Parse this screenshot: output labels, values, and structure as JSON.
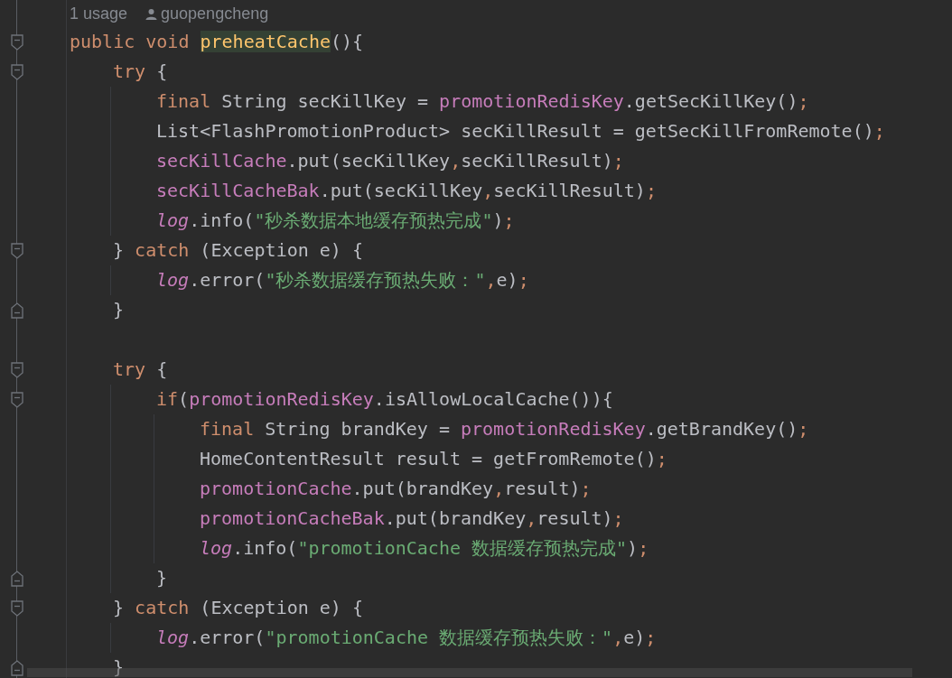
{
  "usage_hint": {
    "usages": "1 usage",
    "author": "guopengcheng"
  },
  "lines": [
    {
      "kind": "opener",
      "tokens": [
        {
          "kind": "keyword",
          "text": "public void "
        },
        {
          "kind": "declaration",
          "text": "preheatCache"
        },
        {
          "kind": "plain",
          "text": "(){"
        }
      ],
      "children": [
        {
          "kind": "opener",
          "tokens": [
            {
              "kind": "keyword",
              "text": "try"
            },
            {
              "kind": "plain",
              "text": " {"
            }
          ],
          "children": [
            {
              "kind": "statement",
              "tokens": [
                {
                  "kind": "keyword",
                  "text": "final"
                },
                {
                  "kind": "plain",
                  "text": " String secKillKey = "
                },
                {
                  "kind": "field",
                  "text": "promotionRedisKey"
                },
                {
                  "kind": "plain",
                  "text": ".getSecKillKey()"
                },
                {
                  "kind": "punct",
                  "text": ";"
                }
              ]
            },
            {
              "kind": "statement",
              "tokens": [
                {
                  "kind": "plain",
                  "text": "List<FlashPromotionProduct> secKillResult = getSecKillFromRemote()"
                },
                {
                  "kind": "punct",
                  "text": ";"
                }
              ]
            },
            {
              "kind": "statement",
              "tokens": [
                {
                  "kind": "field",
                  "text": "secKillCache"
                },
                {
                  "kind": "plain",
                  "text": ".put(secKillKey"
                },
                {
                  "kind": "punct",
                  "text": ","
                },
                {
                  "kind": "plain",
                  "text": "secKillResult)"
                },
                {
                  "kind": "punct",
                  "text": ";"
                }
              ]
            },
            {
              "kind": "statement",
              "tokens": [
                {
                  "kind": "field",
                  "text": "secKillCacheBak"
                },
                {
                  "kind": "plain",
                  "text": ".put(secKillKey"
                },
                {
                  "kind": "punct",
                  "text": ","
                },
                {
                  "kind": "plain",
                  "text": "secKillResult)"
                },
                {
                  "kind": "punct",
                  "text": ";"
                }
              ]
            },
            {
              "kind": "statement",
              "tokens": [
                {
                  "kind": "static",
                  "text": "log"
                },
                {
                  "kind": "plain",
                  "text": ".info("
                },
                {
                  "kind": "string",
                  "text": "\"秒杀数据本地缓存预热完成\""
                },
                {
                  "kind": "plain",
                  "text": ")"
                },
                {
                  "kind": "punct",
                  "text": ";"
                }
              ]
            }
          ]
        },
        {
          "kind": "opener",
          "tokens": [
            {
              "kind": "plain",
              "text": "} "
            },
            {
              "kind": "keyword",
              "text": "catch"
            },
            {
              "kind": "plain",
              "text": " (Exception e) {"
            }
          ],
          "children": [
            {
              "kind": "statement",
              "tokens": [
                {
                  "kind": "static",
                  "text": "log"
                },
                {
                  "kind": "plain",
                  "text": ".error("
                },
                {
                  "kind": "string",
                  "text": "\"秒杀数据缓存预热失败：\""
                },
                {
                  "kind": "punct",
                  "text": ","
                },
                {
                  "kind": "plain",
                  "text": "e)"
                },
                {
                  "kind": "punct",
                  "text": ";"
                }
              ]
            }
          ]
        },
        {
          "kind": "closer",
          "tokens": [
            {
              "kind": "plain",
              "text": "}"
            }
          ]
        },
        {
          "kind": "blank"
        },
        {
          "kind": "opener",
          "tokens": [
            {
              "kind": "keyword",
              "text": "try"
            },
            {
              "kind": "plain",
              "text": " {"
            }
          ],
          "children": [
            {
              "kind": "opener",
              "tokens": [
                {
                  "kind": "keyword",
                  "text": "if"
                },
                {
                  "kind": "plain",
                  "text": "("
                },
                {
                  "kind": "field",
                  "text": "promotionRedisKey"
                },
                {
                  "kind": "plain",
                  "text": ".isAllowLocalCache()){"
                }
              ],
              "children": [
                {
                  "kind": "statement",
                  "tokens": [
                    {
                      "kind": "keyword",
                      "text": "final"
                    },
                    {
                      "kind": "plain",
                      "text": " String brandKey = "
                    },
                    {
                      "kind": "field",
                      "text": "promotionRedisKey"
                    },
                    {
                      "kind": "plain",
                      "text": ".getBrandKey()"
                    },
                    {
                      "kind": "punct",
                      "text": ";"
                    }
                  ]
                },
                {
                  "kind": "statement",
                  "tokens": [
                    {
                      "kind": "plain",
                      "text": "HomeContentResult result = getFromRemote()"
                    },
                    {
                      "kind": "punct",
                      "text": ";"
                    }
                  ]
                },
                {
                  "kind": "statement",
                  "tokens": [
                    {
                      "kind": "field",
                      "text": "promotionCache"
                    },
                    {
                      "kind": "plain",
                      "text": ".put(brandKey"
                    },
                    {
                      "kind": "punct",
                      "text": ","
                    },
                    {
                      "kind": "plain",
                      "text": "result)"
                    },
                    {
                      "kind": "punct",
                      "text": ";"
                    }
                  ]
                },
                {
                  "kind": "statement",
                  "tokens": [
                    {
                      "kind": "field",
                      "text": "promotionCacheBak"
                    },
                    {
                      "kind": "plain",
                      "text": ".put(brandKey"
                    },
                    {
                      "kind": "punct",
                      "text": ","
                    },
                    {
                      "kind": "plain",
                      "text": "result)"
                    },
                    {
                      "kind": "punct",
                      "text": ";"
                    }
                  ]
                },
                {
                  "kind": "statement",
                  "tokens": [
                    {
                      "kind": "static",
                      "text": "log"
                    },
                    {
                      "kind": "plain",
                      "text": ".info("
                    },
                    {
                      "kind": "string",
                      "text": "\"promotionCache 数据缓存预热完成\""
                    },
                    {
                      "kind": "plain",
                      "text": ")"
                    },
                    {
                      "kind": "punct",
                      "text": ";"
                    }
                  ]
                }
              ]
            },
            {
              "kind": "closer",
              "tokens": [
                {
                  "kind": "plain",
                  "text": "}"
                }
              ]
            }
          ]
        },
        {
          "kind": "opener",
          "tokens": [
            {
              "kind": "plain",
              "text": "} "
            },
            {
              "kind": "keyword",
              "text": "catch"
            },
            {
              "kind": "plain",
              "text": " (Exception e) {"
            }
          ],
          "children": [
            {
              "kind": "statement",
              "tokens": [
                {
                  "kind": "static",
                  "text": "log"
                },
                {
                  "kind": "plain",
                  "text": ".error("
                },
                {
                  "kind": "string",
                  "text": "\"promotionCache 数据缓存预热失败：\""
                },
                {
                  "kind": "punct",
                  "text": ","
                },
                {
                  "kind": "plain",
                  "text": "e)"
                },
                {
                  "kind": "punct",
                  "text": ";"
                }
              ]
            }
          ]
        },
        {
          "kind": "closer",
          "tokens": [
            {
              "kind": "plain",
              "text": "}"
            }
          ]
        }
      ]
    }
  ]
}
